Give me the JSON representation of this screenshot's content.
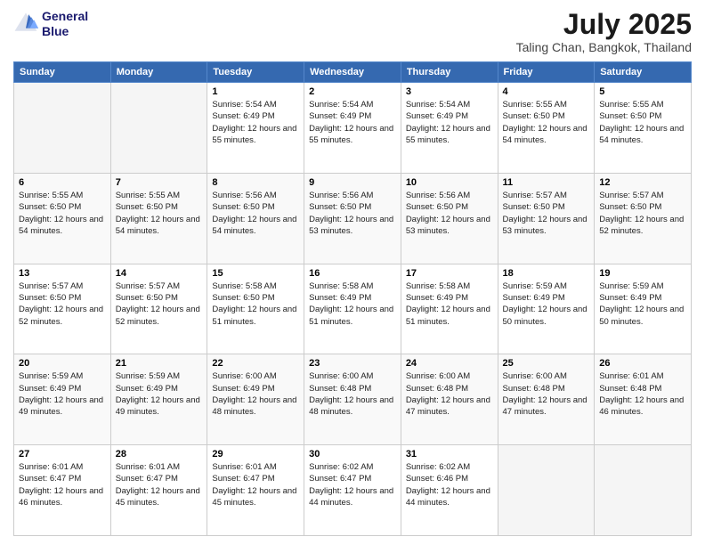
{
  "header": {
    "logo_line1": "General",
    "logo_line2": "Blue",
    "title": "July 2025",
    "subtitle": "Taling Chan, Bangkok, Thailand"
  },
  "days_of_week": [
    "Sunday",
    "Monday",
    "Tuesday",
    "Wednesday",
    "Thursday",
    "Friday",
    "Saturday"
  ],
  "weeks": [
    [
      {
        "day": "",
        "info": ""
      },
      {
        "day": "",
        "info": ""
      },
      {
        "day": "1",
        "info": "Sunrise: 5:54 AM\nSunset: 6:49 PM\nDaylight: 12 hours\nand 55 minutes."
      },
      {
        "day": "2",
        "info": "Sunrise: 5:54 AM\nSunset: 6:49 PM\nDaylight: 12 hours\nand 55 minutes."
      },
      {
        "day": "3",
        "info": "Sunrise: 5:54 AM\nSunset: 6:49 PM\nDaylight: 12 hours\nand 55 minutes."
      },
      {
        "day": "4",
        "info": "Sunrise: 5:55 AM\nSunset: 6:50 PM\nDaylight: 12 hours\nand 54 minutes."
      },
      {
        "day": "5",
        "info": "Sunrise: 5:55 AM\nSunset: 6:50 PM\nDaylight: 12 hours\nand 54 minutes."
      }
    ],
    [
      {
        "day": "6",
        "info": "Sunrise: 5:55 AM\nSunset: 6:50 PM\nDaylight: 12 hours\nand 54 minutes."
      },
      {
        "day": "7",
        "info": "Sunrise: 5:55 AM\nSunset: 6:50 PM\nDaylight: 12 hours\nand 54 minutes."
      },
      {
        "day": "8",
        "info": "Sunrise: 5:56 AM\nSunset: 6:50 PM\nDaylight: 12 hours\nand 54 minutes."
      },
      {
        "day": "9",
        "info": "Sunrise: 5:56 AM\nSunset: 6:50 PM\nDaylight: 12 hours\nand 53 minutes."
      },
      {
        "day": "10",
        "info": "Sunrise: 5:56 AM\nSunset: 6:50 PM\nDaylight: 12 hours\nand 53 minutes."
      },
      {
        "day": "11",
        "info": "Sunrise: 5:57 AM\nSunset: 6:50 PM\nDaylight: 12 hours\nand 53 minutes."
      },
      {
        "day": "12",
        "info": "Sunrise: 5:57 AM\nSunset: 6:50 PM\nDaylight: 12 hours\nand 52 minutes."
      }
    ],
    [
      {
        "day": "13",
        "info": "Sunrise: 5:57 AM\nSunset: 6:50 PM\nDaylight: 12 hours\nand 52 minutes."
      },
      {
        "day": "14",
        "info": "Sunrise: 5:57 AM\nSunset: 6:50 PM\nDaylight: 12 hours\nand 52 minutes."
      },
      {
        "day": "15",
        "info": "Sunrise: 5:58 AM\nSunset: 6:50 PM\nDaylight: 12 hours\nand 51 minutes."
      },
      {
        "day": "16",
        "info": "Sunrise: 5:58 AM\nSunset: 6:49 PM\nDaylight: 12 hours\nand 51 minutes."
      },
      {
        "day": "17",
        "info": "Sunrise: 5:58 AM\nSunset: 6:49 PM\nDaylight: 12 hours\nand 51 minutes."
      },
      {
        "day": "18",
        "info": "Sunrise: 5:59 AM\nSunset: 6:49 PM\nDaylight: 12 hours\nand 50 minutes."
      },
      {
        "day": "19",
        "info": "Sunrise: 5:59 AM\nSunset: 6:49 PM\nDaylight: 12 hours\nand 50 minutes."
      }
    ],
    [
      {
        "day": "20",
        "info": "Sunrise: 5:59 AM\nSunset: 6:49 PM\nDaylight: 12 hours\nand 49 minutes."
      },
      {
        "day": "21",
        "info": "Sunrise: 5:59 AM\nSunset: 6:49 PM\nDaylight: 12 hours\nand 49 minutes."
      },
      {
        "day": "22",
        "info": "Sunrise: 6:00 AM\nSunset: 6:49 PM\nDaylight: 12 hours\nand 48 minutes."
      },
      {
        "day": "23",
        "info": "Sunrise: 6:00 AM\nSunset: 6:48 PM\nDaylight: 12 hours\nand 48 minutes."
      },
      {
        "day": "24",
        "info": "Sunrise: 6:00 AM\nSunset: 6:48 PM\nDaylight: 12 hours\nand 47 minutes."
      },
      {
        "day": "25",
        "info": "Sunrise: 6:00 AM\nSunset: 6:48 PM\nDaylight: 12 hours\nand 47 minutes."
      },
      {
        "day": "26",
        "info": "Sunrise: 6:01 AM\nSunset: 6:48 PM\nDaylight: 12 hours\nand 46 minutes."
      }
    ],
    [
      {
        "day": "27",
        "info": "Sunrise: 6:01 AM\nSunset: 6:47 PM\nDaylight: 12 hours\nand 46 minutes."
      },
      {
        "day": "28",
        "info": "Sunrise: 6:01 AM\nSunset: 6:47 PM\nDaylight: 12 hours\nand 45 minutes."
      },
      {
        "day": "29",
        "info": "Sunrise: 6:01 AM\nSunset: 6:47 PM\nDaylight: 12 hours\nand 45 minutes."
      },
      {
        "day": "30",
        "info": "Sunrise: 6:02 AM\nSunset: 6:47 PM\nDaylight: 12 hours\nand 44 minutes."
      },
      {
        "day": "31",
        "info": "Sunrise: 6:02 AM\nSunset: 6:46 PM\nDaylight: 12 hours\nand 44 minutes."
      },
      {
        "day": "",
        "info": ""
      },
      {
        "day": "",
        "info": ""
      }
    ]
  ]
}
